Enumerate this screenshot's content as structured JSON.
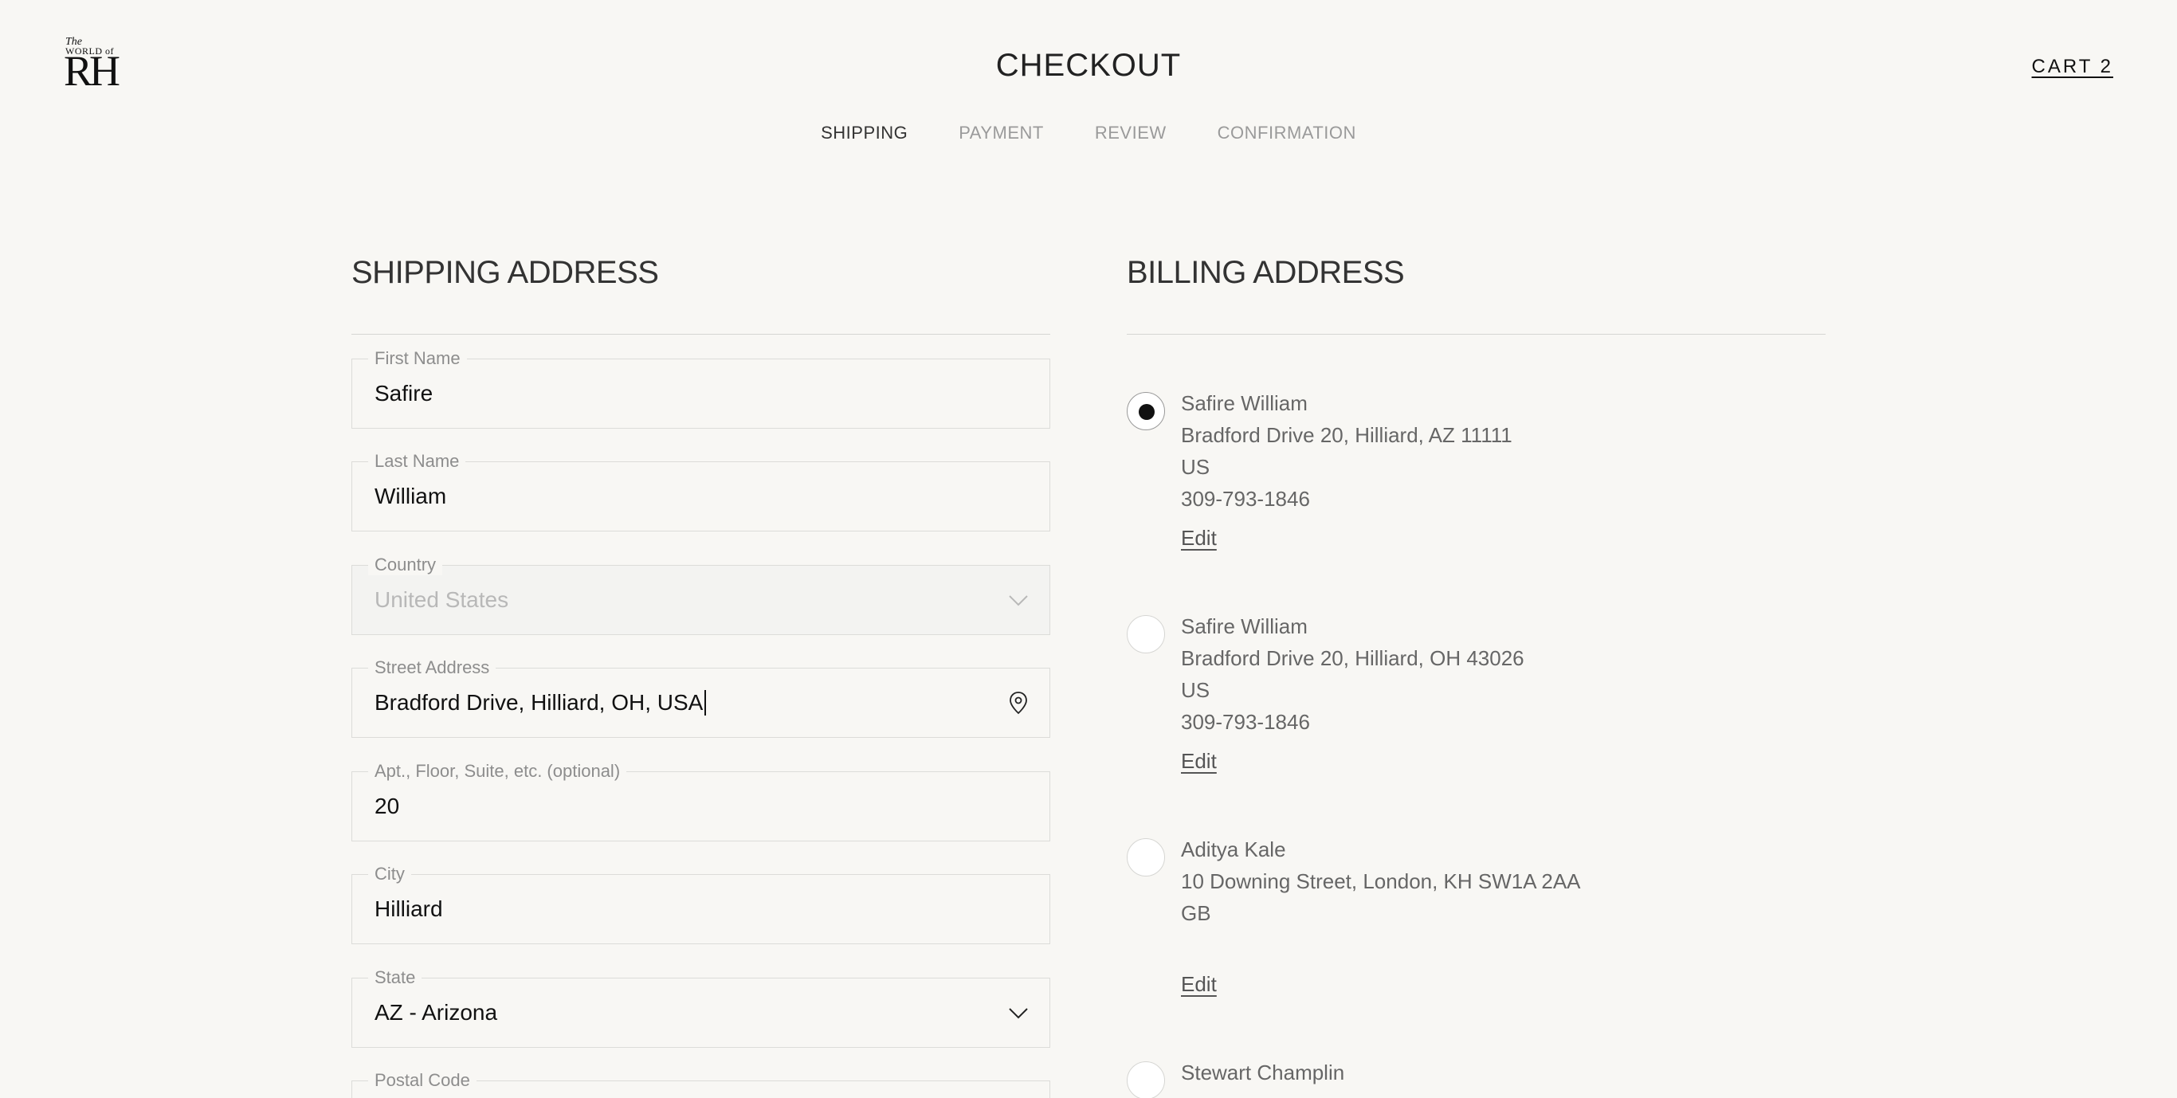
{
  "header": {
    "logo_the": "The",
    "logo_world": "WORLD of",
    "logo_mark": "RH",
    "title": "CHECKOUT",
    "cart_label": "CART 2"
  },
  "steps": [
    {
      "label": "SHIPPING",
      "active": true
    },
    {
      "label": "PAYMENT",
      "active": false
    },
    {
      "label": "REVIEW",
      "active": false
    },
    {
      "label": "CONFIRMATION",
      "active": false
    }
  ],
  "shipping": {
    "title": "SHIPPING ADDRESS",
    "fields": {
      "first_name": {
        "label": "First Name",
        "value": "Safire"
      },
      "last_name": {
        "label": "Last Name",
        "value": "William"
      },
      "country": {
        "label": "Country",
        "value": "United States",
        "disabled": true,
        "icon": "chevron-down-icon"
      },
      "street": {
        "label": "Street Address",
        "value": "Bradford Drive, Hilliard, OH, USA",
        "icon": "location-pin-icon"
      },
      "apt": {
        "label": "Apt., Floor, Suite, etc. (optional)",
        "value": "20"
      },
      "city": {
        "label": "City",
        "value": "Hilliard"
      },
      "state": {
        "label": "State",
        "value": "AZ - Arizona",
        "icon": "chevron-down-icon"
      },
      "postal": {
        "label": "Postal Code",
        "value": ""
      }
    }
  },
  "billing": {
    "title": "BILLING ADDRESS",
    "edit_label": "Edit",
    "addresses": [
      {
        "name": "Safire William",
        "line": "Bradford Drive 20, Hilliard, AZ 11111",
        "country": "US",
        "phone": "309-793-1846",
        "selected": true
      },
      {
        "name": "Safire William",
        "line": "Bradford Drive 20, Hilliard, OH 43026",
        "country": "US",
        "phone": "309-793-1846",
        "selected": false
      },
      {
        "name": "Aditya Kale",
        "line": "10 Downing Street, London, KH SW1A 2AA",
        "country": "GB",
        "phone": "",
        "selected": false
      },
      {
        "name": "Stewart Champlin",
        "line": "",
        "country": "",
        "phone": "",
        "selected": false
      }
    ]
  }
}
